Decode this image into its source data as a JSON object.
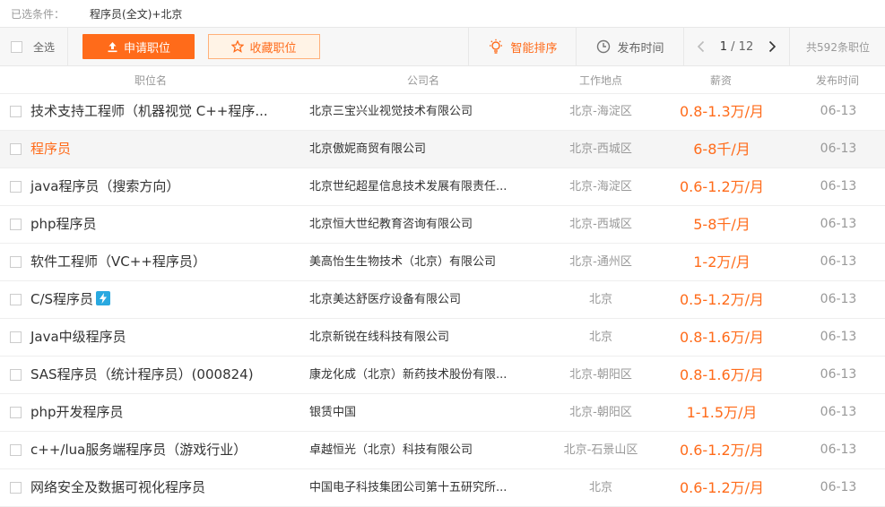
{
  "filter": {
    "label": "已选条件：",
    "value": "程序员(全文)+北京"
  },
  "toolbar": {
    "select_all": "全选",
    "apply": "申请职位",
    "favorite": "收藏职位",
    "sort_smart": "智能排序",
    "sort_time": "发布时间",
    "page_current": "1",
    "page_total": "/ 12",
    "total_count": "共592条职位"
  },
  "columns": {
    "title": "职位名",
    "company": "公司名",
    "location": "工作地点",
    "salary": "薪资",
    "date": "发布时间"
  },
  "colors": {
    "accent": "#ff6b1a",
    "muted": "#999999",
    "bolt": "#29a9e0"
  },
  "jobs": [
    {
      "title": "技术支持工程师（机器视觉 C++程序...",
      "company": "北京三宝兴业视觉技术有限公司",
      "location": "北京-海淀区",
      "salary": "0.8-1.3万/月",
      "date": "06-13"
    },
    {
      "title": "程序员",
      "company": "北京傲妮商贸有限公司",
      "location": "北京-西城区",
      "salary": "6-8千/月",
      "date": "06-13"
    },
    {
      "title": "java程序员（搜索方向）",
      "company": "北京世纪超星信息技术发展有限责任...",
      "location": "北京-海淀区",
      "salary": "0.6-1.2万/月",
      "date": "06-13"
    },
    {
      "title": "php程序员",
      "company": "北京恒大世纪教育咨询有限公司",
      "location": "北京-西城区",
      "salary": "5-8千/月",
      "date": "06-13"
    },
    {
      "title": "软件工程师（VC++程序员）",
      "company": "美高怡生生物技术（北京）有限公司",
      "location": "北京-通州区",
      "salary": "1-2万/月",
      "date": "06-13"
    },
    {
      "title": "C/S程序员",
      "company": "北京美达舒医疗设备有限公司",
      "location": "北京",
      "salary": "0.5-1.2万/月",
      "date": "06-13"
    },
    {
      "title": "Java中级程序员",
      "company": "北京新锐在线科技有限公司",
      "location": "北京",
      "salary": "0.8-1.6万/月",
      "date": "06-13"
    },
    {
      "title": "SAS程序员（统计程序员）(000824)",
      "company": "康龙化成（北京）新药技术股份有限...",
      "location": "北京-朝阳区",
      "salary": "0.8-1.6万/月",
      "date": "06-13"
    },
    {
      "title": "php开发程序员",
      "company": "银赁中国",
      "location": "北京-朝阳区",
      "salary": "1-1.5万/月",
      "date": "06-13"
    },
    {
      "title": "c++/lua服务端程序员（游戏行业）",
      "company": "卓越恒光（北京）科技有限公司",
      "location": "北京-石景山区",
      "salary": "0.6-1.2万/月",
      "date": "06-13"
    },
    {
      "title": "网络安全及数据可视化程序员",
      "company": "中国电子科技集团公司第十五研究所...",
      "location": "北京",
      "salary": "0.6-1.2万/月",
      "date": "06-13"
    }
  ]
}
